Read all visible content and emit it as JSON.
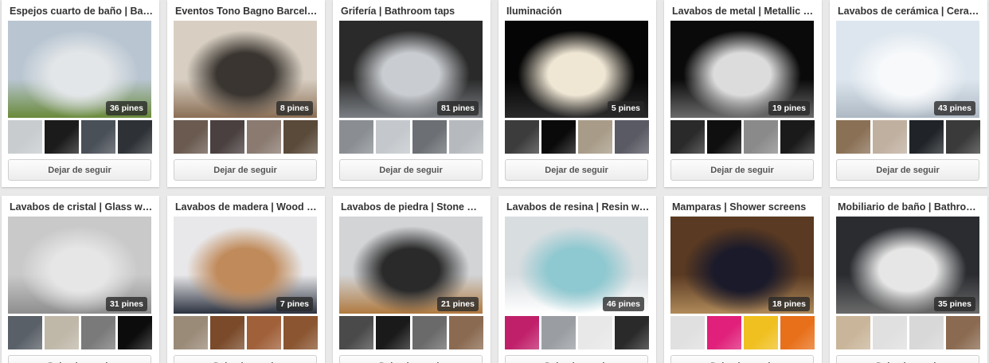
{
  "unfollow_label": "Dejar de seguir",
  "boards_row1": [
    {
      "title": "Espejos cuarto de baño | Bat…",
      "pins": "36 pines",
      "cover": [
        "#b9c6d2",
        "#e3e6e8",
        "#6a8a3a"
      ],
      "thumbs": [
        "#c8ccce",
        "#1b1b1b",
        "#4a5058",
        "#2e3236"
      ]
    },
    {
      "title": "Eventos Tono Bagno Barcelo…",
      "pins": "8 pines",
      "cover": [
        "#d8cfc2",
        "#3a3530",
        "#8a6e55"
      ],
      "thumbs": [
        "#6a5a50",
        "#4a4040",
        "#8a7a70",
        "#5a4a3a"
      ]
    },
    {
      "title": "Grifería | Bathroom taps",
      "pins": "81 pines",
      "cover": [
        "#2a2a2a",
        "#c9ccd0",
        "#7b7f84"
      ],
      "thumbs": [
        "#8a8e92",
        "#c4c8cc",
        "#6c7074",
        "#b6babe"
      ]
    },
    {
      "title": "Iluminación",
      "pins": "5 pines",
      "cover": [
        "#050505",
        "#efe6d4",
        "#2a2a2a"
      ],
      "thumbs": [
        "#3c3c3c",
        "#0a0a0a",
        "#a89c88",
        "#5a5a64"
      ]
    },
    {
      "title": "Lavabos de metal | Metallic …",
      "pins": "19 pines",
      "cover": [
        "#0a0a0a",
        "#dcdcdc",
        "#6a6a6a"
      ],
      "thumbs": [
        "#2a2a2a",
        "#0f0f0f",
        "#8a8a8a",
        "#1a1a1a"
      ]
    },
    {
      "title": "Lavabos de cerámica | Cera…",
      "pins": "43 pines",
      "cover": [
        "#dde6ee",
        "#f7f9fb",
        "#aeb9c4"
      ],
      "thumbs": [
        "#8a7055",
        "#c0b0a0",
        "#202428",
        "#3a3a3a"
      ]
    }
  ],
  "boards_row2": [
    {
      "title": "Lavabos de cristal | Glass w…",
      "pins": "31 pines",
      "cover": [
        "#c9c9c9",
        "#e6e6e6",
        "#8e8e8e"
      ],
      "thumbs": [
        "#5a6068",
        "#bfb7a8",
        "#7a7a7a",
        "#0c0c0c"
      ]
    },
    {
      "title": "Lavabos de madera | Wood …",
      "pins": "7 pines",
      "cover": [
        "#e8e8ea",
        "#c08a5a",
        "#2c3240"
      ],
      "thumbs": [
        "#9a8a78",
        "#7a4a2a",
        "#a0603a",
        "#8a5530"
      ]
    },
    {
      "title": "Lavabos de piedra | Stone w…",
      "pins": "21 pines",
      "cover": [
        "#d2d4d6",
        "#2a2a2a",
        "#b07a40"
      ],
      "thumbs": [
        "#4a4a4a",
        "#1a1a1a",
        "#6a6a6a",
        "#8a6a50"
      ]
    },
    {
      "title": "Lavabos de resina | Resin w…",
      "pins": "46 pines",
      "cover": [
        "#d8dde0",
        "#8ec8d0",
        "#ffffff"
      ],
      "thumbs": [
        "#c0206a",
        "#9a9ea2",
        "#e8e8e8",
        "#2a2a2a"
      ]
    },
    {
      "title": "Mamparas | Shower screens",
      "pins": "18 pines",
      "cover": [
        "#5a3a22",
        "#1a1a2a",
        "#b08a5a"
      ],
      "thumbs": [
        "#e0e0e0",
        "#e0207a",
        "#f0c020",
        "#e8701a"
      ]
    },
    {
      "title": "Mobiliario de baño | Bathroo…",
      "pins": "35 pines",
      "cover": [
        "#2a2c30",
        "#e6e6e6",
        "#6a6a6a"
      ],
      "thumbs": [
        "#c9b59a",
        "#e0e0e0",
        "#d8d8d8",
        "#8a6a50"
      ]
    }
  ]
}
